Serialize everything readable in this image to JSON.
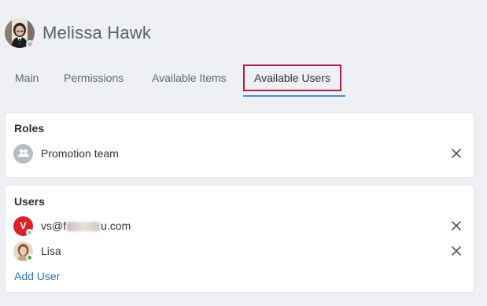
{
  "header": {
    "title": "Melissa Hawk",
    "avatar_status_color": "#b7bcc3"
  },
  "tabs": [
    {
      "label": "Main"
    },
    {
      "label": "Permissions"
    },
    {
      "label": "Available Items"
    },
    {
      "label": "Available Users",
      "active": true
    }
  ],
  "roles": {
    "title": "Roles",
    "items": [
      {
        "label": "Promotion team",
        "icon": "group-icon"
      }
    ]
  },
  "users": {
    "title": "Users",
    "items": [
      {
        "label_prefix": "vs@f",
        "label_suffix": "u.com",
        "initial": "V",
        "avatar_color": "#d8232a",
        "status_color": "#b7bcc3"
      },
      {
        "label": "Lisa",
        "status_color": "#4caf50"
      }
    ],
    "add_label": "Add User"
  },
  "colors": {
    "accent": "#2f77b8",
    "active_tab_border": "#b01e4e",
    "tab_underline": "#4a90c8"
  }
}
